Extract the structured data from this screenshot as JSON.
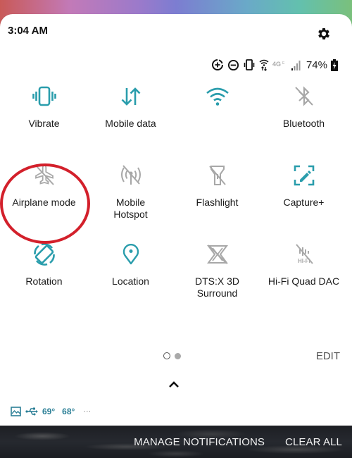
{
  "status_bar": {
    "time": "3:04 AM",
    "network_type": "4G",
    "battery_percent": "74%",
    "icons": [
      "data-saver-icon",
      "do-not-disturb-icon",
      "vibrate-icon",
      "wifi-data-icon",
      "4g-icon",
      "signal-icon",
      "battery-icon"
    ]
  },
  "quick_settings": {
    "accent_color": "#2a9dac",
    "inactive_color": "#a8a8a8",
    "tiles": [
      {
        "label": "Vibrate",
        "icon": "vibrate-icon",
        "active": true
      },
      {
        "label": "Mobile data",
        "icon": "mobile-data-icon",
        "active": true
      },
      {
        "label": "",
        "icon": "wifi-icon",
        "active": true
      },
      {
        "label": "Bluetooth",
        "icon": "bluetooth-off-icon",
        "active": false
      },
      {
        "label": "Airplane mode",
        "icon": "airplane-off-icon",
        "active": false
      },
      {
        "label": "Mobile\nHotspot",
        "icon": "hotspot-off-icon",
        "active": false
      },
      {
        "label": "Flashlight",
        "icon": "flashlight-off-icon",
        "active": false
      },
      {
        "label": "Capture+",
        "icon": "capture-plus-icon",
        "active": true
      },
      {
        "label": "Rotation",
        "icon": "rotation-icon",
        "active": true
      },
      {
        "label": "Location",
        "icon": "location-icon",
        "active": true
      },
      {
        "label": "DTS:X 3D\nSurround",
        "icon": "dts-x-off-icon",
        "active": false
      },
      {
        "label": "Hi-Fi Quad DAC",
        "icon": "hifi-dac-off-icon",
        "active": false
      }
    ],
    "page_indicator": {
      "current": 1,
      "total": 2
    },
    "edit_label": "EDIT"
  },
  "notification_strip": {
    "temp_high": "69°",
    "temp_low": "68°",
    "more": "···"
  },
  "footer": {
    "manage_label": "MANAGE NOTIFICATIONS",
    "clear_label": "CLEAR ALL"
  },
  "annotation": {
    "target": "Airplane mode",
    "color": "#d3202b"
  }
}
